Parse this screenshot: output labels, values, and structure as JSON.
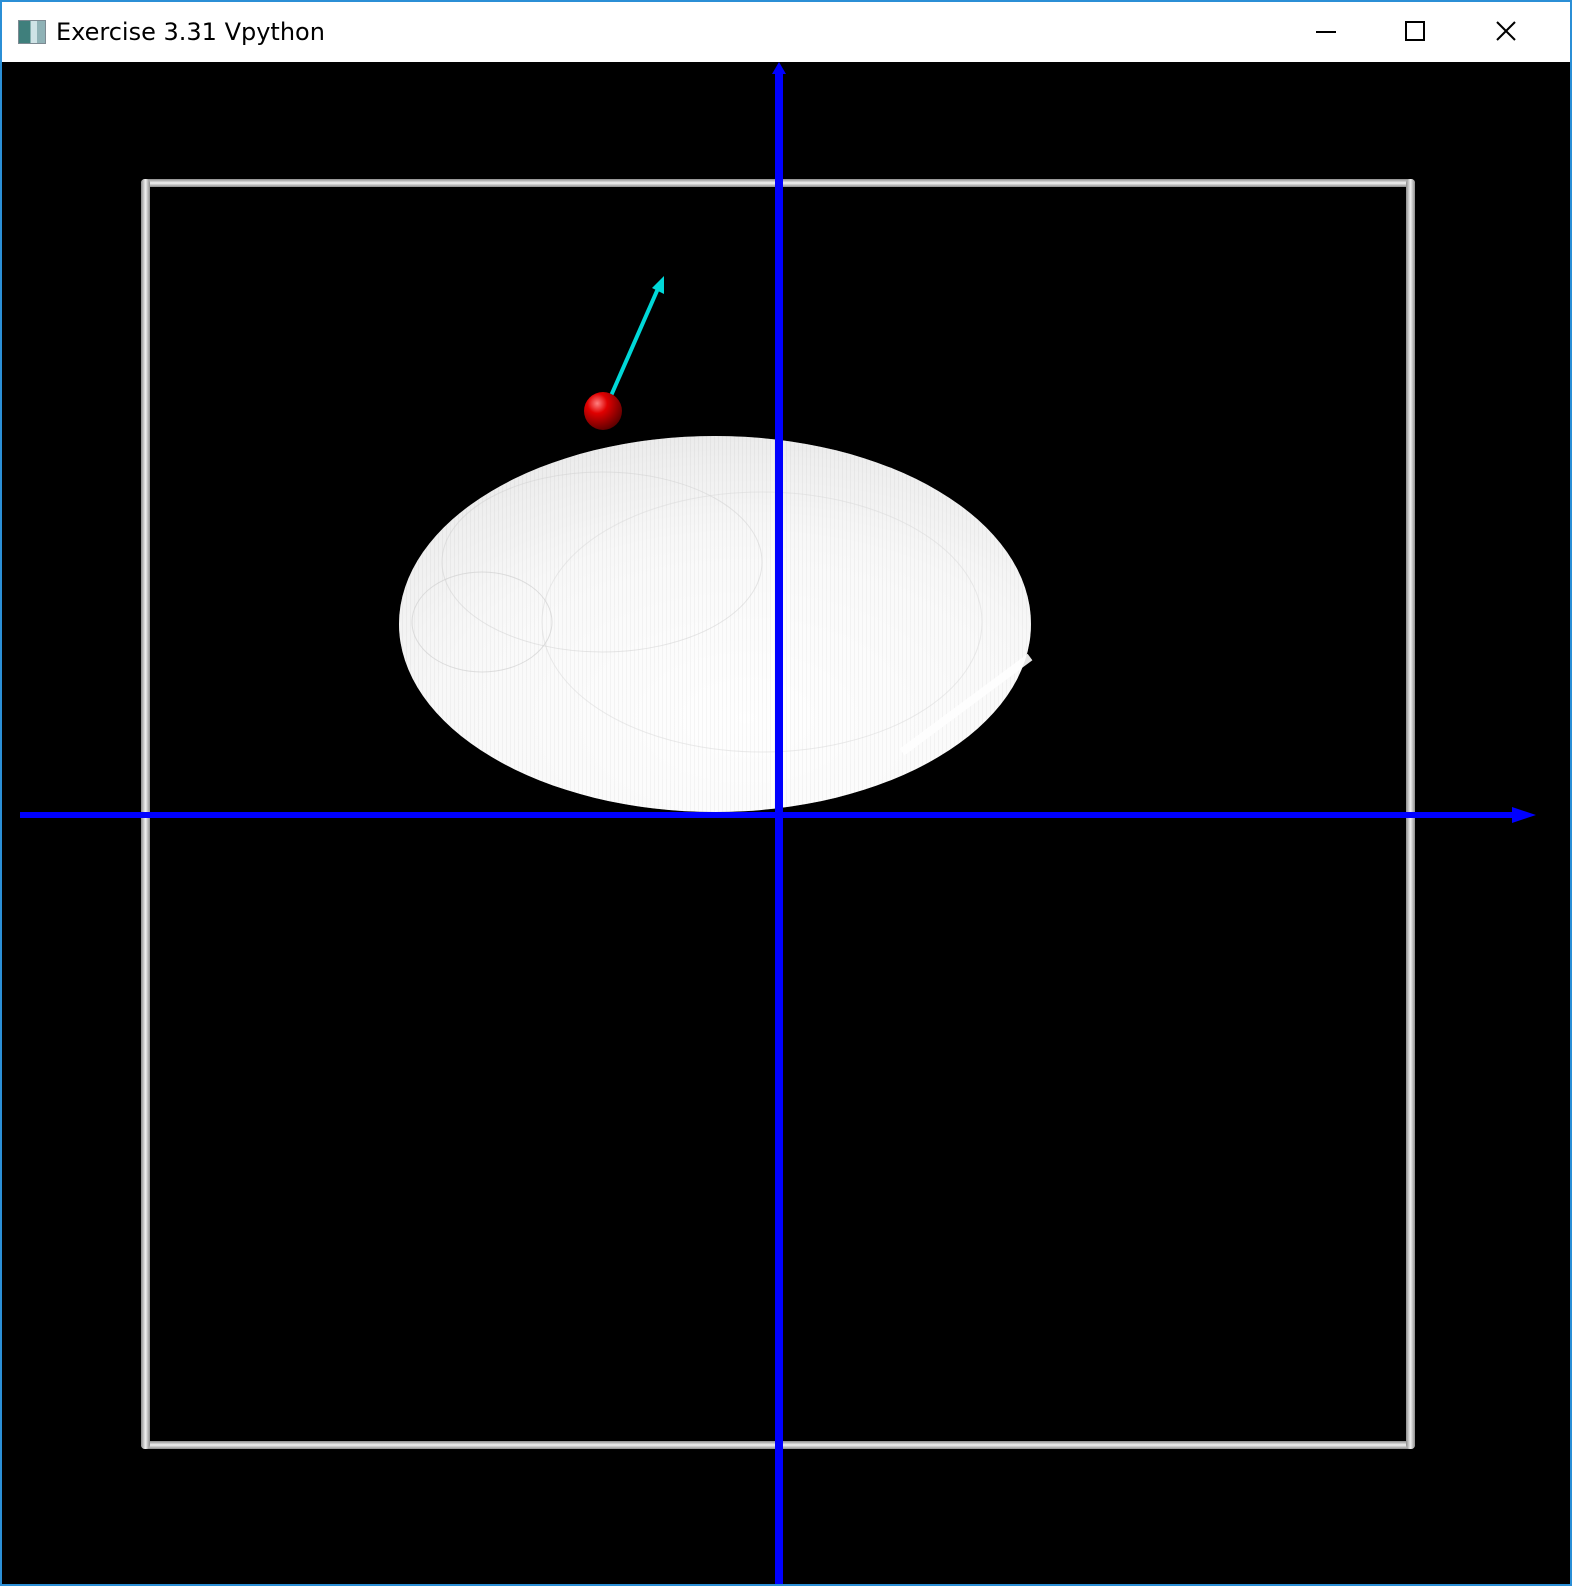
{
  "window": {
    "title": "Exercise 3.31 Vpython",
    "controls": {
      "minimize_icon": "minimize-icon",
      "maximize_icon": "maximize-icon",
      "close_icon": "close-icon"
    }
  },
  "scene": {
    "background_color": "#000000",
    "objects": [
      {
        "kind": "box-frame",
        "color": "#d9d9d9"
      },
      {
        "kind": "x-axis-arrow",
        "color": "#0000ff"
      },
      {
        "kind": "y-axis-arrow",
        "color": "#0000ff"
      },
      {
        "kind": "ellipsoid-trail",
        "color": "#ffffff"
      },
      {
        "kind": "sphere",
        "color": "#e00000"
      },
      {
        "kind": "velocity-arrow",
        "color": "#00d8d8"
      }
    ]
  }
}
